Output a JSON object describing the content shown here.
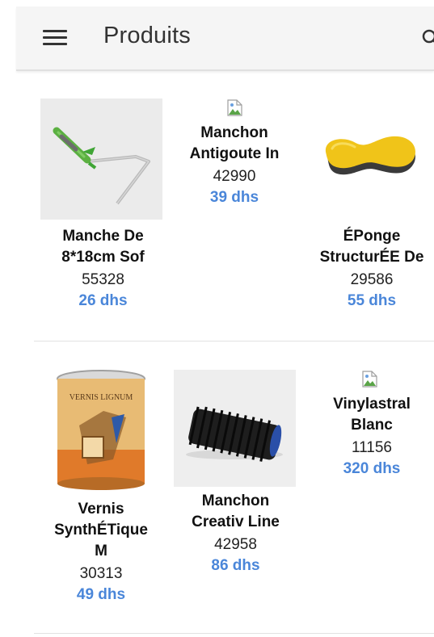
{
  "appbar": {
    "title": "Produits"
  },
  "products": [
    {
      "name_l1": "Manchon",
      "name_l2": "Antigoute In",
      "code": "42990",
      "price": "39 dhs",
      "image": "broken-image-icon"
    },
    {
      "name_l1": "Manche De",
      "name_l2": "8*18cm Sof",
      "code": "55328",
      "price": "26 dhs",
      "image": "paint-roller-handle"
    },
    {
      "name_l1": "ÉPonge",
      "name_l2": "StructurÉE De",
      "code": "29586",
      "price": "55 dhs",
      "image": "yellow-sponge"
    },
    {
      "name_l1": "Vernis",
      "name_l2": "SynthÉTique",
      "name_l3": "M",
      "code": "30313",
      "price": "49 dhs",
      "image": "varnish-can",
      "can_label": "VERNIS LIGNUM"
    },
    {
      "name_l1": "Manchon",
      "name_l2": "Creativ Line",
      "code": "42958",
      "price": "86 dhs",
      "image": "black-roller-sleeve"
    },
    {
      "name_l1": "Vinylastral",
      "name_l2": "Blanc",
      "code": "11156",
      "price": "320 dhs",
      "image": "broken-image-icon"
    }
  ],
  "colors": {
    "price": "#4a86d9",
    "appbar_bg": "#f5f5f5",
    "text": "#111111"
  }
}
